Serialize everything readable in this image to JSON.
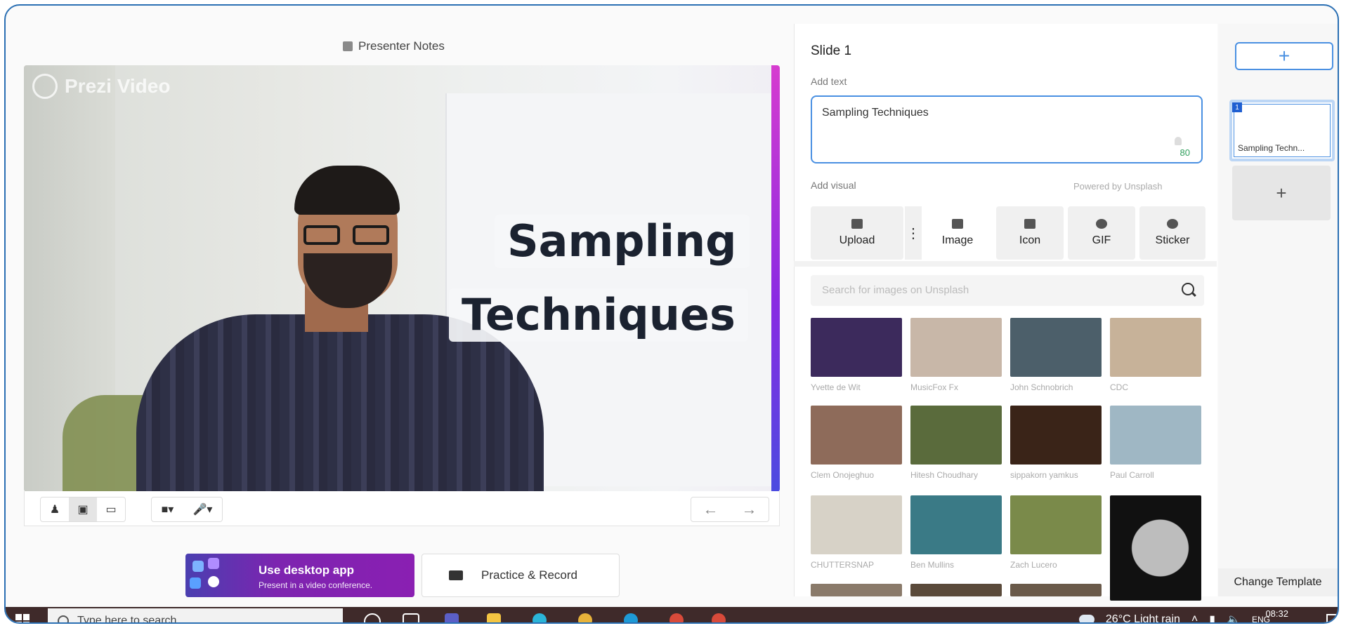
{
  "presenter_notes": {
    "label": "Presenter Notes"
  },
  "video": {
    "logo_text": "Prezi Video",
    "title_line1": "Sampling",
    "title_line2": "Techniques"
  },
  "controls": {
    "layout_buttons": [
      "person-icon",
      "person-screen-icon",
      "screen-icon"
    ],
    "active_layout": "person-screen-icon",
    "camera_icon": "camera-icon",
    "mic_icon": "microphone-icon",
    "prev": "←",
    "next": "→"
  },
  "desktop_app": {
    "title": "Use desktop app",
    "subtitle": "Present in a video conference."
  },
  "practice": {
    "label": "Practice & Record"
  },
  "panel": {
    "slide_title": "Slide 1",
    "add_text_label": "Add text",
    "text_value": "Sampling Techniques",
    "char_count": "80",
    "add_visual_label": "Add visual",
    "powered_by": "Powered by  Unsplash",
    "tabs": [
      {
        "label": "Upload",
        "icon": "upload-icon"
      },
      {
        "label": "Image",
        "icon": "image-icon"
      },
      {
        "label": "Icon",
        "icon": "flag-icon"
      },
      {
        "label": "GIF",
        "icon": "gif-icon"
      },
      {
        "label": "Sticker",
        "icon": "sticker-icon"
      }
    ],
    "active_tab": "Image",
    "search_placeholder": "Search for images on Unsplash",
    "images": [
      {
        "caption": "Yvette de Wit",
        "color": "#3c2a5c"
      },
      {
        "caption": "MusicFox Fx",
        "color": "#c8b7a8"
      },
      {
        "caption": "John Schnobrich",
        "color": "#4c5f6a"
      },
      {
        "caption": "CDC",
        "color": "#c7b299"
      },
      {
        "caption": "Clem Onojeghuo",
        "color": "#8e6b5a"
      },
      {
        "caption": "Hitesh Choudhary",
        "color": "#5a6b3c"
      },
      {
        "caption": "sippakorn yamkus",
        "color": "#3a2418"
      },
      {
        "caption": "Paul Carroll",
        "color": "#9fb7c4"
      },
      {
        "caption": "CHUTTERSNAP",
        "color": "#d7d2c7"
      },
      {
        "caption": "Ben Mullins",
        "color": "#3a7a86"
      },
      {
        "caption": "Zach Lucero",
        "color": "#7a8a4a"
      },
      {
        "caption": "",
        "color": "#111111"
      }
    ]
  },
  "slides": {
    "add_label": "+",
    "items": [
      {
        "number": "1",
        "label": "Sampling Techn..."
      }
    ],
    "new_slide": "+",
    "change_template": "Change Template"
  },
  "taskbar": {
    "search_placeholder": "Type here to search",
    "weather": "26°C  Light rain",
    "language": "ENG",
    "time": "08:32",
    "date": "",
    "apps": [
      {
        "name": "cortana-icon",
        "color": "#ffffff"
      },
      {
        "name": "task-view-icon",
        "color": "#ffffff"
      },
      {
        "name": "teams-icon",
        "color": "#5b5fc7"
      },
      {
        "name": "file-explorer-icon",
        "color": "#f4c542"
      },
      {
        "name": "cortana-ring-icon",
        "color": "#2bb5d8"
      },
      {
        "name": "chrome-icon",
        "color": "#e8b33a"
      },
      {
        "name": "edge-icon",
        "color": "#1e9ad6"
      },
      {
        "name": "chrome-active-icon",
        "color": "#d94a3a"
      },
      {
        "name": "chrome-profile-icon",
        "color": "#d94a3a"
      }
    ]
  }
}
